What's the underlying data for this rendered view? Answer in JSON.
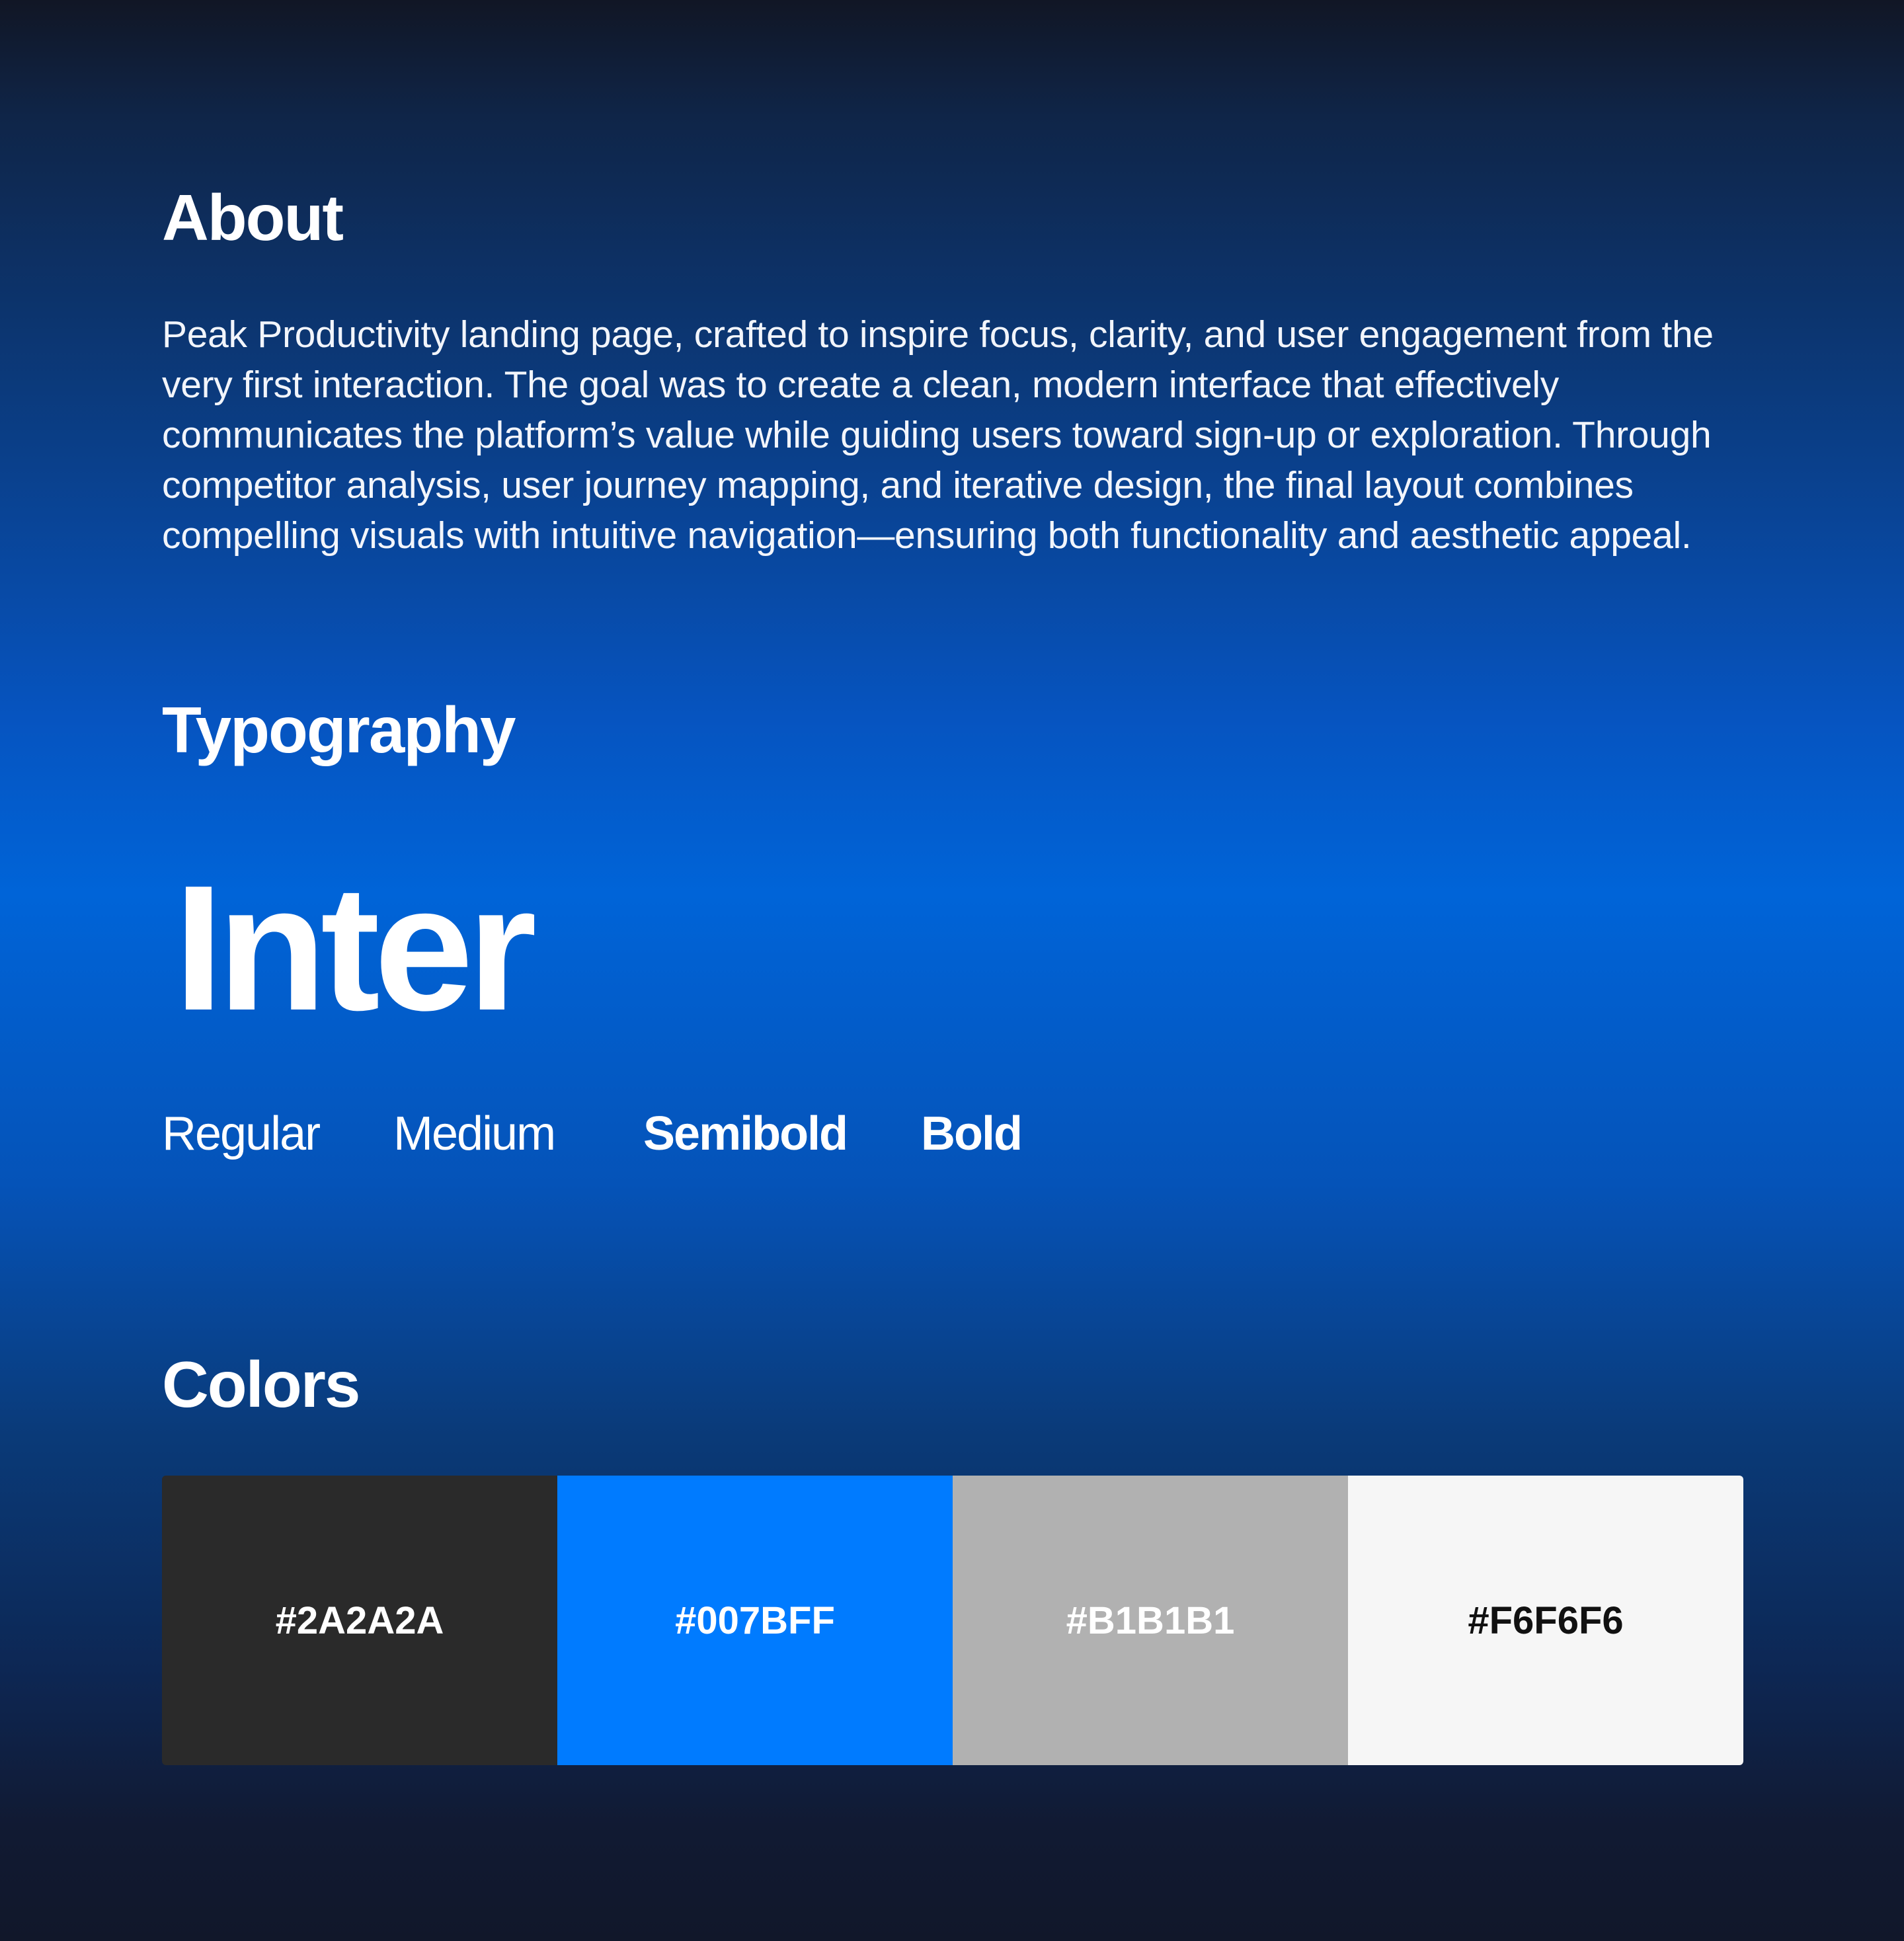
{
  "about": {
    "title": "About",
    "body": "Peak Productivity landing page, crafted to inspire focus, clarity, and user engagement from the very first interaction. The goal was to create a clean, modern interface that effectively communicates the platform’s value while guiding users toward sign-up or exploration. Through competitor analysis, user journey mapping, and iterative design, the final layout combines compelling visuals with intuitive navigation—ensuring both functionality and aesthetic appeal."
  },
  "typography": {
    "title": "Typography",
    "font_name": "Inter",
    "weights": [
      "Regular",
      "Medium",
      "Semibold",
      "Bold"
    ]
  },
  "colors": {
    "title": "Colors",
    "swatches": [
      {
        "label": "#2A2A2A",
        "hex": "#2A2A2A"
      },
      {
        "label": "#007BFF",
        "hex": "#007BFF"
      },
      {
        "label": "#B1B1B1",
        "hex": "#B1B1B1"
      },
      {
        "label": "#F6F6F6",
        "hex": "#F6F6F6"
      }
    ]
  }
}
